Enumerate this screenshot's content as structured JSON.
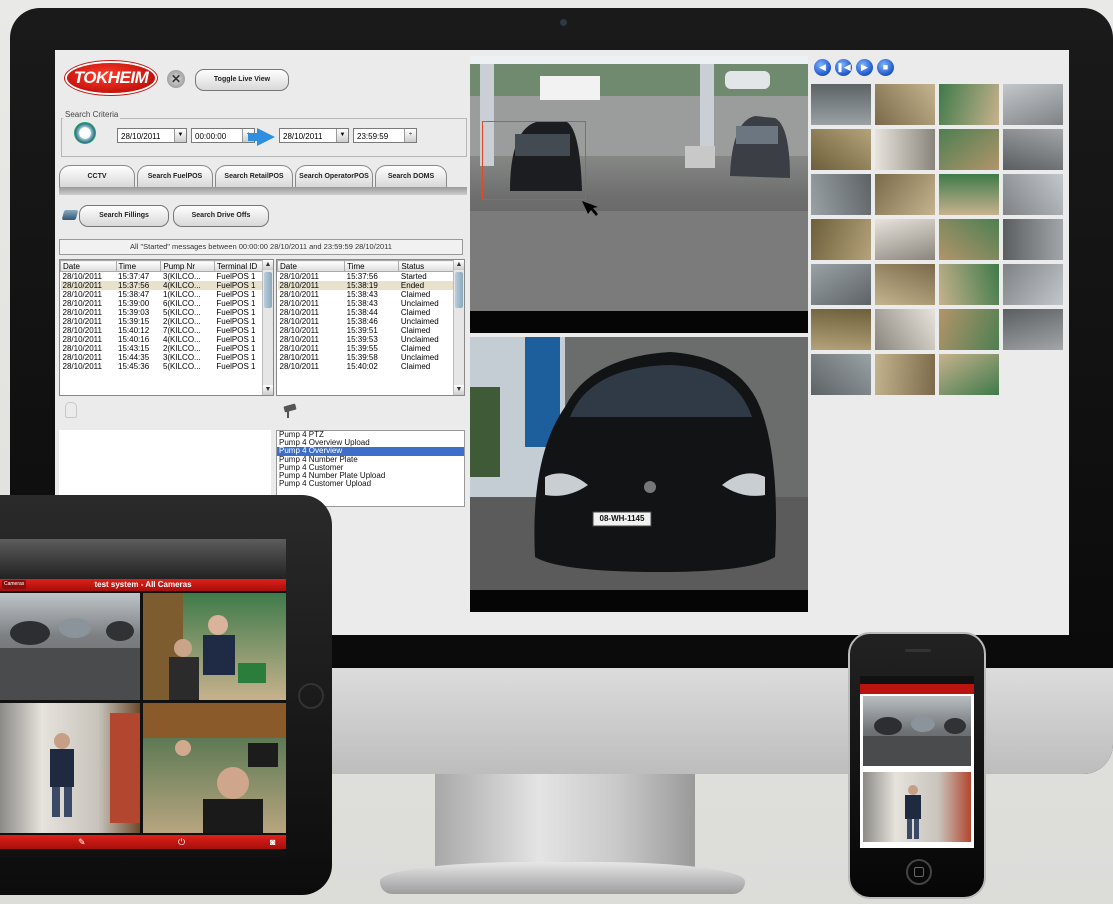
{
  "app": {
    "logo_text": "TOKHEIM",
    "toggle_live_view": "Toggle Live View",
    "search_criteria_label": "Search Criteria",
    "from_date": "28/10/2011",
    "from_time": "00:00:00",
    "to_date": "28/10/2011",
    "to_time": "23:59:59",
    "tabs": [
      "CCTV",
      "Search FuelPOS",
      "Search RetailPOS",
      "Search OperatorPOS",
      "Search DOMS"
    ],
    "search_fillings": "Search Fillings",
    "search_drive_offs": "Search Drive Offs",
    "status_message": "All \"Started\" messages between 00:00:00 28/10/2011 and 23:59:59 28/10/2011",
    "left_table": {
      "headers": [
        "Date",
        "Time",
        "Pump Nr",
        "Terminal ID"
      ],
      "rows": [
        [
          "28/10/2011",
          "15:37:47",
          "3(KILCO...",
          "FuelPOS 1"
        ],
        [
          "28/10/2011",
          "15:37:56",
          "4(KILCO...",
          "FuelPOS 1"
        ],
        [
          "28/10/2011",
          "15:38:47",
          "1(KILCO...",
          "FuelPOS 1"
        ],
        [
          "28/10/2011",
          "15:39:00",
          "6(KILCO...",
          "FuelPOS 1"
        ],
        [
          "28/10/2011",
          "15:39:03",
          "5(KILCO...",
          "FuelPOS 1"
        ],
        [
          "28/10/2011",
          "15:39:15",
          "2(KILCO...",
          "FuelPOS 1"
        ],
        [
          "28/10/2011",
          "15:40:12",
          "7(KILCO...",
          "FuelPOS 1"
        ],
        [
          "28/10/2011",
          "15:40:16",
          "4(KILCO...",
          "FuelPOS 1"
        ],
        [
          "28/10/2011",
          "15:43:15",
          "2(KILCO...",
          "FuelPOS 1"
        ],
        [
          "28/10/2011",
          "15:44:35",
          "3(KILCO...",
          "FuelPOS 1"
        ],
        [
          "28/10/2011",
          "15:45:36",
          "5(KILCO...",
          "FuelPOS 1"
        ]
      ]
    },
    "right_table": {
      "headers": [
        "Date",
        "Time",
        "Status"
      ],
      "rows": [
        [
          "28/10/2011",
          "15:37:56",
          "Started"
        ],
        [
          "28/10/2011",
          "15:38:19",
          "Ended"
        ],
        [
          "28/10/2011",
          "15:38:43",
          "Claimed"
        ],
        [
          "28/10/2011",
          "15:38:43",
          "Unclaimed"
        ],
        [
          "28/10/2011",
          "15:38:44",
          "Claimed"
        ],
        [
          "28/10/2011",
          "15:38:46",
          "Unclaimed"
        ],
        [
          "28/10/2011",
          "15:39:51",
          "Claimed"
        ],
        [
          "28/10/2011",
          "15:39:53",
          "Unclaimed"
        ],
        [
          "28/10/2011",
          "15:39:55",
          "Claimed"
        ],
        [
          "28/10/2011",
          "15:39:58",
          "Unclaimed"
        ],
        [
          "28/10/2011",
          "15:40:02",
          "Claimed"
        ]
      ]
    },
    "camera_list": [
      "Pump 4 PTZ",
      "Pump 4 Overview Upload",
      "Pump 4 Overview",
      "Pump 4 Number Plate",
      "Pump 4 Customer",
      "Pump 4 Number Plate Upload",
      "Pump 4 Customer Upload"
    ],
    "camera_list_selected_index": 2,
    "plate_text": "08-WH-1145"
  },
  "ipad": {
    "title": "test system - All Cameras",
    "cameras_button": "Cameras"
  },
  "colors": {
    "accent_red": "#d4180f",
    "selection_blue": "#3d6ec9",
    "highlight_box": "#e24a28"
  }
}
